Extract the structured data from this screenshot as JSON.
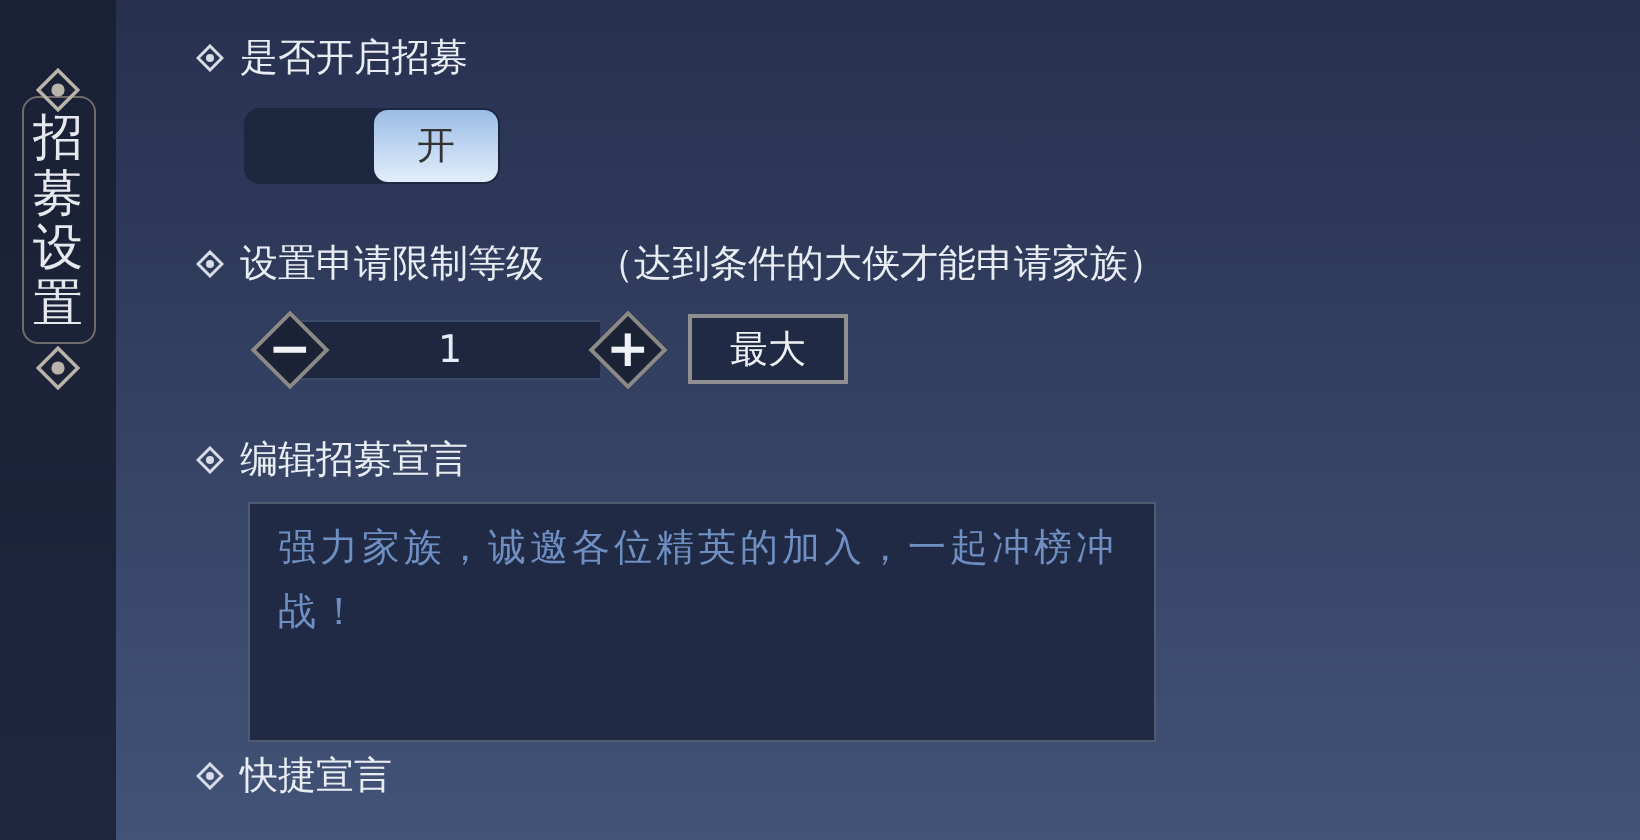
{
  "sidebar": {
    "title": "招募设置"
  },
  "sections": [
    {
      "kind": "toggle",
      "label": "是否开启招募",
      "on": true,
      "thumb_label": "开"
    },
    {
      "kind": "stepper",
      "label": "设置申请限制等级",
      "note": "（达到条件的大侠才能申请家族）",
      "value": "1",
      "minus": "−",
      "plus": "+",
      "max_button": "最大"
    },
    {
      "kind": "textarea",
      "label": "编辑招募宣言",
      "value": "强力家族，诚邀各位精英的加入，一起冲榜冲战！"
    },
    {
      "kind": "heading",
      "label": "快捷宣言"
    }
  ]
}
